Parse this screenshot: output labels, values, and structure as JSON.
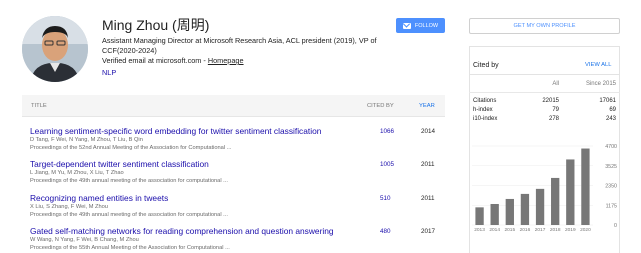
{
  "profile": {
    "name": "Ming Zhou (周明)",
    "affiliation": "Assistant Managing Director at Microsoft Research Asia, ACL president (2019), VP of CCF(2020-2024)",
    "email_text": "Verified email at microsoft.com - ",
    "homepage_label": "Homepage",
    "interest": "NLP",
    "follow_label": "FOLLOW",
    "get_profile_label": "GET MY OWN PROFILE"
  },
  "table": {
    "col_title": "TITLE",
    "col_cited": "CITED BY",
    "col_year": "YEAR",
    "rows": [
      {
        "title": "Learning sentiment-specific word embedding for twitter sentiment classification",
        "authors": "D Tang, F Wei, N Yang, M Zhou, T Liu, B Qin",
        "venue": "Proceedings of the 52nd Annual Meeting of the Association for Computational ...",
        "cited": "1066",
        "year": "2014"
      },
      {
        "title": "Target-dependent twitter sentiment classification",
        "authors": "L Jiang, M Yu, M Zhou, X Liu, T Zhao",
        "venue": "Proceedings of the 49th annual meeting of the association for computational ...",
        "cited": "1005",
        "year": "2011"
      },
      {
        "title": "Recognizing named entities in tweets",
        "authors": "X Liu, S Zhang, F Wei, M Zhou",
        "venue": "Proceedings of the 49th annual meeting of the association for computational ...",
        "cited": "510",
        "year": "2011"
      },
      {
        "title": "Gated self-matching networks for reading comprehension and question answering",
        "authors": "W Wang, N Yang, F Wei, B Chang, M Zhou",
        "venue": "Proceedings of the 55th Annual Meeting of the Association for Computational ...",
        "cited": "480",
        "year": "2017"
      }
    ]
  },
  "cited_by": {
    "title": "Cited by",
    "view_all": "VIEW ALL",
    "head_all": "All",
    "head_since": "Since 2015",
    "stats": [
      {
        "label": "Citations",
        "all": "22015",
        "since": "17061"
      },
      {
        "label": "h-index",
        "all": "79",
        "since": "69"
      },
      {
        "label": "i10-index",
        "all": "278",
        "since": "243"
      }
    ]
  },
  "chart_data": {
    "type": "bar",
    "categories": [
      "2013",
      "2014",
      "2015",
      "2016",
      "2017",
      "2018",
      "2019",
      "2020"
    ],
    "values": [
      1050,
      1250,
      1550,
      1850,
      2150,
      2800,
      3900,
      4550
    ],
    "y_ticks": [
      0,
      1175,
      2350,
      3525,
      4700
    ],
    "ylim": [
      0,
      4700
    ],
    "bar_color": "#777777"
  },
  "colors": {
    "link": "#1a0dab",
    "accent": "#4d90fe"
  }
}
